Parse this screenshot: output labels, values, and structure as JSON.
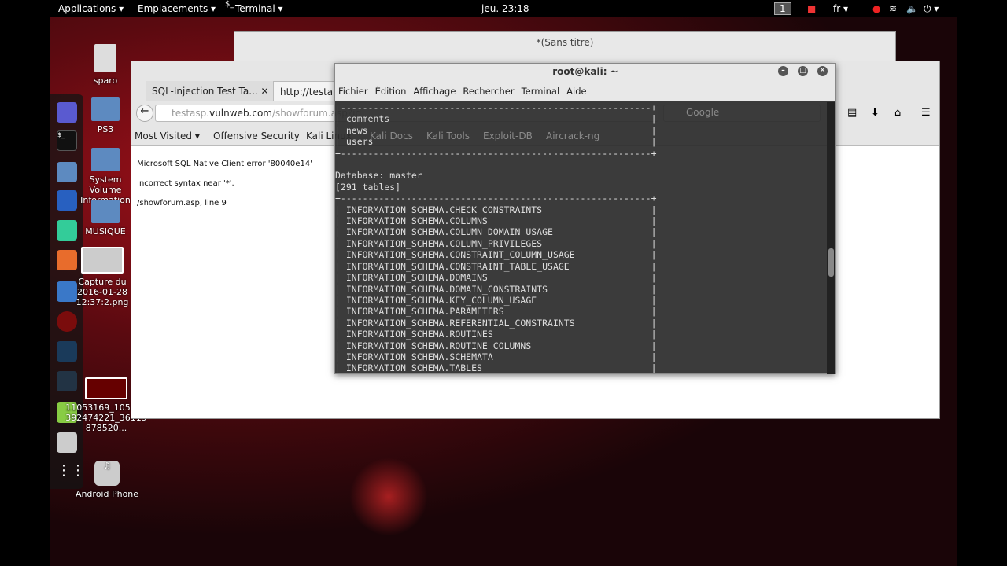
{
  "topbar": {
    "applications": "Applications ▾",
    "places": "Emplacements ▾",
    "terminal": "Terminal ▾",
    "clock": "jeu. 23:18",
    "workspace": "1",
    "lang": "fr ▾"
  },
  "desktop": [
    {
      "label": "sparo"
    },
    {
      "label": "PS3"
    },
    {
      "label": "System Volume Information"
    },
    {
      "label": "MUSIQUE"
    },
    {
      "label": "Capture du 2016-01-28 12:37:2.png"
    },
    {
      "label": "11053169_105312392474221_36119878520..."
    },
    {
      "label": "Android Phone"
    }
  ],
  "gedit": {
    "title": "*(Sans titre)"
  },
  "firefox": {
    "tabs": [
      "SQL-Injection Test Ta...",
      "http://testa..."
    ],
    "url_host": "testasp.",
    "url_domain": "vulnweb.com",
    "url_path": "/showforum.asp?id",
    "search_placeholder": "Google",
    "bookmarks": [
      "Most Visited ▾",
      "Offensive Security",
      "Kali Linux",
      "Kali Docs",
      "Kali Tools",
      "Exploit-DB",
      "Aircrack-ng"
    ],
    "page": [
      "Microsoft SQL Native Client error '80040e14'",
      "Incorrect syntax near '*'.",
      "/showforum.asp, line 9"
    ]
  },
  "terminal": {
    "title": "root@kali: ~",
    "menu": [
      "Fichier",
      "Édition",
      "Affichage",
      "Rechercher",
      "Terminal",
      "Aide"
    ],
    "output": "+---------------------------------------------------------+\n| comments                                                |\n| news                                                    |\n| users                                                   |\n+---------------------------------------------------------+\n\nDatabase: master\n[291 tables]\n+---------------------------------------------------------+\n| INFORMATION_SCHEMA.CHECK_CONSTRAINTS                    |\n| INFORMATION_SCHEMA.COLUMNS                              |\n| INFORMATION_SCHEMA.COLUMN_DOMAIN_USAGE                  |\n| INFORMATION_SCHEMA.COLUMN_PRIVILEGES                    |\n| INFORMATION_SCHEMA.CONSTRAINT_COLUMN_USAGE              |\n| INFORMATION_SCHEMA.CONSTRAINT_TABLE_USAGE               |\n| INFORMATION_SCHEMA.DOMAINS                              |\n| INFORMATION_SCHEMA.DOMAIN_CONSTRAINTS                   |\n| INFORMATION_SCHEMA.KEY_COLUMN_USAGE                     |\n| INFORMATION_SCHEMA.PARAMETERS                           |\n| INFORMATION_SCHEMA.REFERENTIAL_CONSTRAINTS              |\n| INFORMATION_SCHEMA.ROUTINES                             |\n| INFORMATION_SCHEMA.ROUTINE_COLUMNS                      |\n| INFORMATION_SCHEMA.SCHEMATA                             |\n| INFORMATION_SCHEMA.TABLES                               |"
  }
}
